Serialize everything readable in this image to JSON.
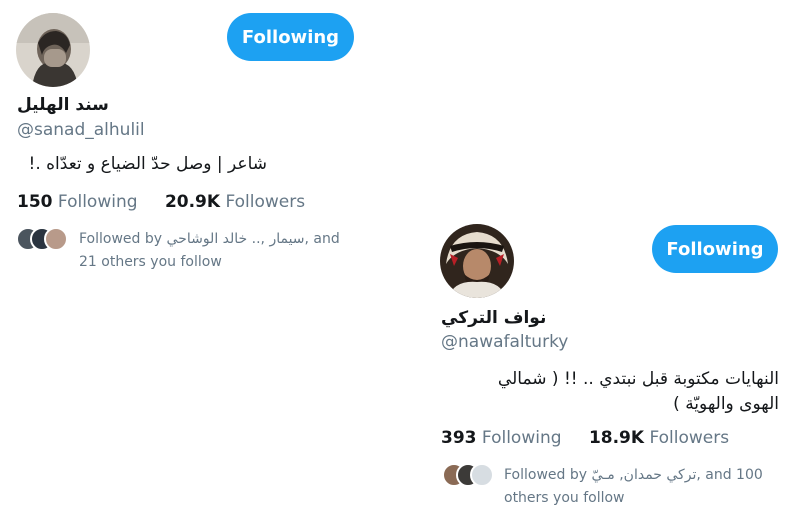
{
  "cards": [
    {
      "display_name": "سند الهليل",
      "handle": "@sanad_alhulil",
      "follow_button_label": "Following",
      "bio": "شاعر | وصل حدّ الضياع و تعدّاه .!",
      "following_count": "150",
      "following_label": "Following",
      "followers_count": "20.9K",
      "followers_label": "Followers",
      "followed_by_line1": "Followed by ﺳﻴﻤﺎﺭ ,.. ﺧﺎﻟﺪ ﺍﻟﻮﺷﺎﺣﻲ, and",
      "followed_by_line2": "21 others you follow"
    },
    {
      "display_name": "نواف التركي",
      "handle": "@nawafalturky",
      "follow_button_label": "Following",
      "bio_line1": "النهايات مكتوبة قبل نبتدي .. !!  ( شمالي",
      "bio_line2": "الهوى والهويّة )",
      "following_count": "393",
      "following_label": "Following",
      "followers_count": "18.9K",
      "followers_label": "Followers",
      "followed_by_line1": "Followed by ﺗﺮﻛﻲ ﺣﻤﺪﺍﻥ, ﻣـﻲّ, and 100",
      "followed_by_line2": "others you follow"
    }
  ],
  "colors": {
    "accent": "#1da1f2",
    "secondary_text": "#657786",
    "primary_text": "#14171a"
  },
  "icons": {
    "avatar_1": "profile-photo",
    "avatar_2": "profile-photo"
  }
}
